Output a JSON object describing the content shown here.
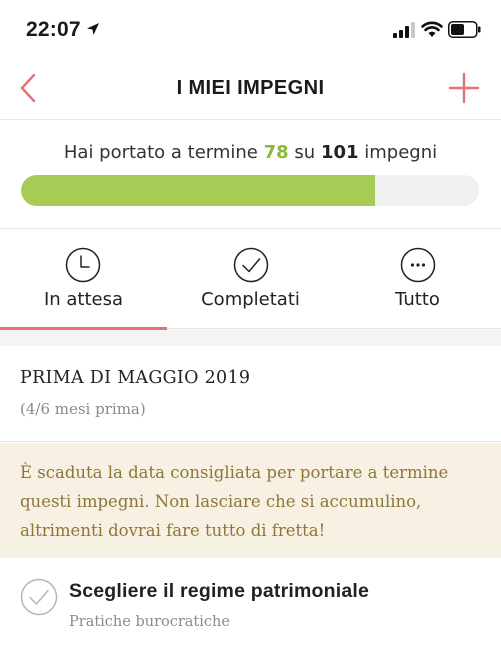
{
  "status_bar": {
    "time": "22:07",
    "icons": [
      "location-arrow-icon",
      "signal-icon",
      "wifi-icon",
      "battery-icon"
    ]
  },
  "nav": {
    "title": "I MIEI IMPEGNI",
    "back_icon": "chevron-left-icon",
    "add_icon": "plus-icon",
    "accent_color": "#e57373"
  },
  "progress": {
    "prefix": "Hai portato a termine",
    "done": "78",
    "connector": "su",
    "total": "101",
    "suffix": "impegni",
    "fraction": 0.772,
    "fill_color": "#a6cc55"
  },
  "tabs": [
    {
      "label": "In attesa",
      "icon": "clock-icon",
      "active": true
    },
    {
      "label": "Completati",
      "icon": "check-circle-icon",
      "active": false
    },
    {
      "label": "Tutto",
      "icon": "more-circle-icon",
      "active": false
    }
  ],
  "group": {
    "title": "PRIMA DI MAGGIO 2019",
    "subtitle": "(4/6 mesi prima)"
  },
  "warning": {
    "text": "È scaduta la data consigliata per portare a termine questi impegni. Non lasciare che si accumulino, altrimenti dovrai fare tutto di fretta!",
    "background": "#f7f1e3",
    "text_color": "#8f7538"
  },
  "tasks": [
    {
      "title": "Scegliere il regime patrimoniale",
      "category": "Pratiche burocratiche",
      "icon": "check-circle-icon"
    }
  ]
}
